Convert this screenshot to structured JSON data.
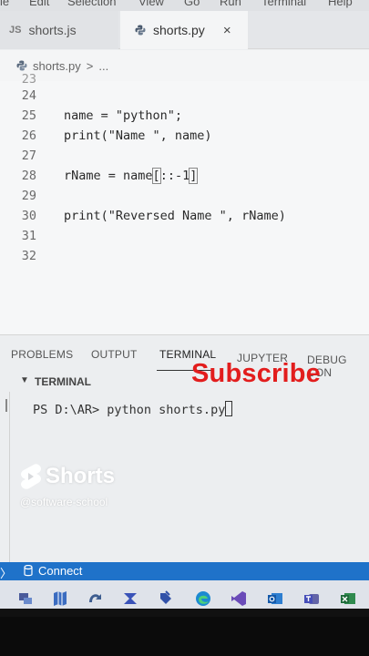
{
  "menubar": {
    "items": [
      "le",
      "Edit",
      "Selection",
      "View",
      "Go",
      "Run",
      "Terminal",
      "Help"
    ]
  },
  "tabs": [
    {
      "badge": "JS",
      "label": "shorts.js"
    },
    {
      "label": "shorts.py",
      "close": "×"
    }
  ],
  "breadcrumb": {
    "file": "shorts.py",
    "separator": ">",
    "rest": "..."
  },
  "editor": {
    "partial_line": "23",
    "lines": [
      {
        "num": "24",
        "code": ""
      },
      {
        "num": "25",
        "code": "name = \"python\";"
      },
      {
        "num": "26",
        "code": "print(\"Name \", name)"
      },
      {
        "num": "27",
        "code": ""
      },
      {
        "num": "28",
        "code_before": "rName = name",
        "code_cursor": "[",
        "code_mid": "::-1",
        "code_after": "]"
      },
      {
        "num": "29",
        "code": ""
      },
      {
        "num": "30",
        "code": "print(\"Reversed Name \", rName)"
      },
      {
        "num": "31",
        "code": ""
      },
      {
        "num": "32",
        "code": ""
      }
    ]
  },
  "panel": {
    "tabs": [
      "PROBLEMS",
      "OUTPUT",
      "TERMINAL",
      "JUPYTER",
      "DEBUG CON"
    ],
    "active_tab": "TERMINAL",
    "section_title": "TERMINAL",
    "prompt": "PS D:\\AR> python shorts.py"
  },
  "overlay": {
    "subscribe": "Subscribe",
    "shorts_brand": "Shorts",
    "channel": "@software-school"
  },
  "statusbar": {
    "connect_label": "Connect"
  },
  "taskbar": {
    "icons": [
      "network-tool-icon",
      "maps-icon",
      "vs-sync-icon",
      "power-automate-icon",
      "store-icon",
      "edge-icon",
      "visual-studio-icon",
      "outlook-icon",
      "teams-icon",
      "excel-icon"
    ]
  },
  "colors": {
    "accent": "#1f72c9",
    "subscribe": "#e21d1d",
    "editor_bg": "#f6f7f8"
  }
}
